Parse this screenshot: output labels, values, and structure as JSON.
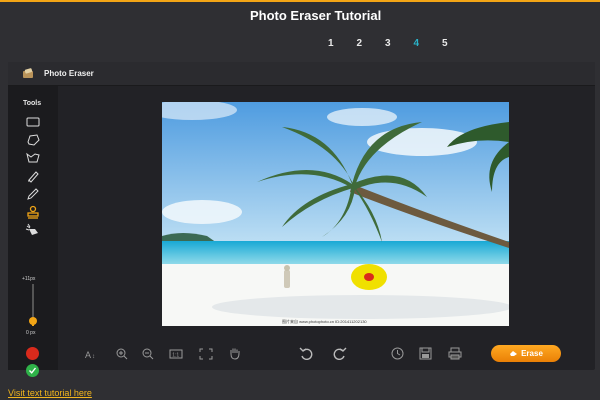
{
  "header": {
    "title": "Photo Eraser Tutorial",
    "steps": [
      "1",
      "2",
      "3",
      "4",
      "5"
    ],
    "active_step": "4"
  },
  "app": {
    "title": "Photo Eraser",
    "tools_label": "Tools",
    "tools": [
      "rectangle-select-icon",
      "lasso-icon",
      "polygon-lasso-icon",
      "brush-icon",
      "pencil-icon",
      "stamp-icon",
      "smart-eraser-icon"
    ],
    "active_tool": "stamp-icon",
    "brush_size": {
      "max_label": "+11px",
      "min_label": "0 px",
      "level_fraction": 0.12
    },
    "colors": {
      "accent": "#f2a516",
      "active_step": "#2ab3c9",
      "red_mark": "#d92a1c",
      "green_confirm": "#2fb349",
      "highlight_yellow": "#f0e000"
    },
    "bottom_toolbar": [
      "text-size-icon",
      "zoom-in-icon",
      "zoom-out-icon",
      "actual-size-icon",
      "fit-screen-icon",
      "hand-pan-icon",
      "undo-icon",
      "redo-icon",
      "history-icon",
      "save-icon",
      "print-icon"
    ],
    "erase_label": "Erase",
    "photo_watermark": "图片来自 www.photophoto.cn  ID:201411202130"
  },
  "footer": {
    "link_text": "Visit text tutorial here"
  }
}
